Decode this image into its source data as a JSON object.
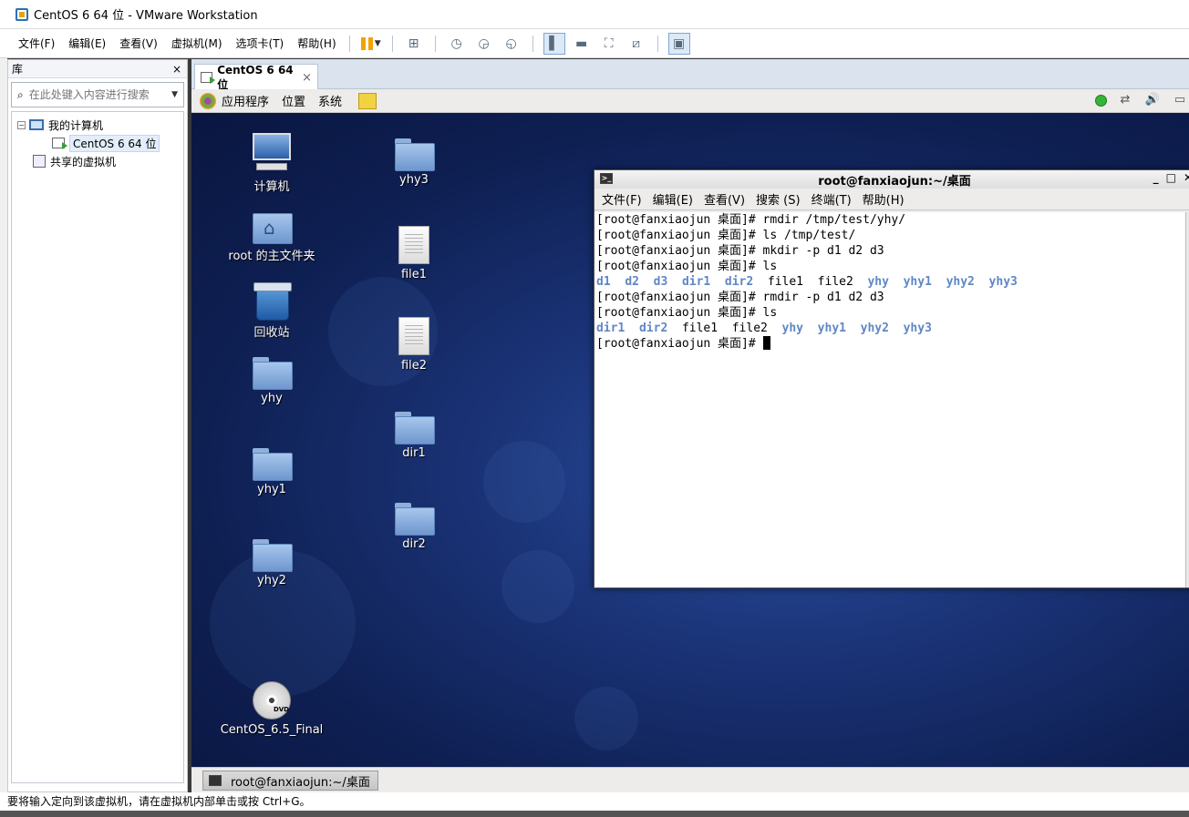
{
  "window": {
    "title": "CentOS 6 64 位 - VMware Workstation"
  },
  "menubar": {
    "items": [
      "文件(F)",
      "编辑(E)",
      "查看(V)",
      "虚拟机(M)",
      "选项卡(T)",
      "帮助(H)"
    ]
  },
  "library": {
    "title": "库",
    "close": "×",
    "search_placeholder": "在此处键入内容进行搜索",
    "tree": {
      "root": "我的计算机",
      "vm": "CentOS 6 64 位",
      "shared": "共享的虚拟机"
    }
  },
  "tab": {
    "label": "CentOS 6 64 位",
    "close": "×"
  },
  "gnome_panel": {
    "applications": "应用程序",
    "places": "位置",
    "system": "系统"
  },
  "desktop": {
    "icons": [
      {
        "label": "计算机"
      },
      {
        "label": "root 的主文件夹"
      },
      {
        "label": "回收站"
      },
      {
        "label": "yhy"
      },
      {
        "label": "yhy1"
      },
      {
        "label": "yhy2"
      },
      {
        "label": "CentOS_6.5_Final"
      },
      {
        "label": "yhy3"
      },
      {
        "label": "file1"
      },
      {
        "label": "file2"
      },
      {
        "label": "dir1"
      },
      {
        "label": "dir2"
      }
    ],
    "dvd_badge": "DVD"
  },
  "terminal": {
    "title": "root@fanxiaojun:~/桌面",
    "menu": [
      "文件(F)",
      "编辑(E)",
      "查看(V)",
      "搜索 (S)",
      "终端(T)",
      "帮助(H)"
    ],
    "prompt": "[root@fanxiaojun 桌面]# ",
    "lines": [
      {
        "cmd": "rmdir /tmp/test/yhy/"
      },
      {
        "cmd": "ls /tmp/test/"
      },
      {
        "cmd": "mkdir -p d1 d2 d3"
      },
      {
        "cmd": "ls"
      },
      {
        "out": [
          "d1",
          "d2",
          "d3",
          "dir1",
          "dir2",
          "file1",
          "file2",
          "yhy",
          "yhy1",
          "yhy2",
          "yhy3"
        ],
        "dirs": [
          0,
          1,
          2,
          3,
          4,
          7,
          8,
          9,
          10
        ]
      },
      {
        "cmd": "rmdir -p d1 d2 d3"
      },
      {
        "cmd": "ls"
      },
      {
        "out": [
          "dir1",
          "dir2",
          "file1",
          "file2",
          "yhy",
          "yhy1",
          "yhy2",
          "yhy3"
        ],
        "dirs": [
          0,
          1,
          4,
          5,
          6,
          7
        ]
      },
      {
        "cmd": ""
      }
    ]
  },
  "taskbar": {
    "item": "root@fanxiaojun:~/桌面"
  },
  "statusbar": {
    "text": "要将输入定向到该虚拟机，请在虚拟机内部单击或按 Ctrl+G。"
  }
}
